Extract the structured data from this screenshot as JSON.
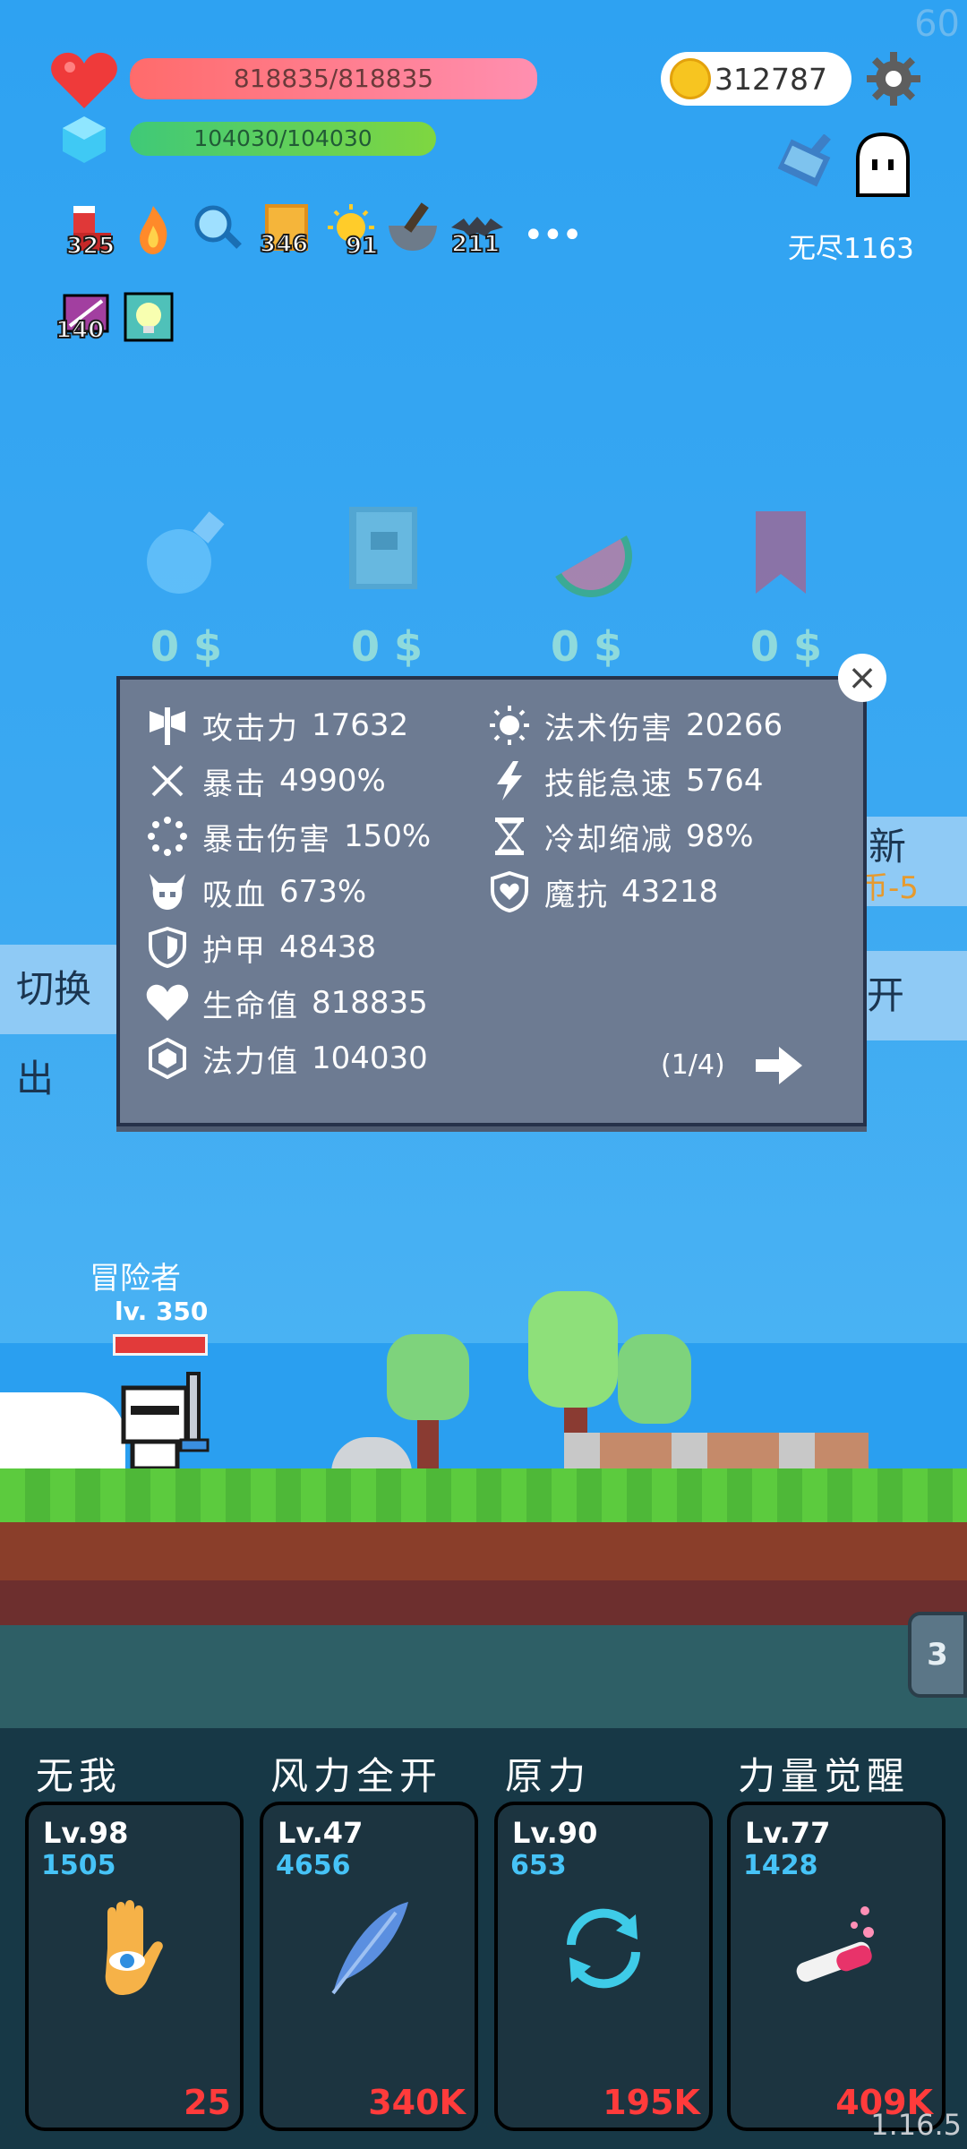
{
  "hud": {
    "fps": "60",
    "hp_text": "818835/818835",
    "mp_text": "104030/104030",
    "gold": "312787",
    "endless_label": "无尽1163",
    "version": "1.16.5"
  },
  "buffs": [
    {
      "icon": "boot-icon",
      "count": "325"
    },
    {
      "icon": "flame-icon",
      "count": ""
    },
    {
      "icon": "magnifier-icon",
      "count": ""
    },
    {
      "icon": "book-icon",
      "count": "346"
    },
    {
      "icon": "sun-icon",
      "count": "91"
    },
    {
      "icon": "mortar-icon",
      "count": ""
    },
    {
      "icon": "bat-icon",
      "count": "211"
    },
    {
      "icon": "scroll-icon",
      "count": "140"
    },
    {
      "icon": "lamp-icon",
      "count": ""
    }
  ],
  "shop": [
    {
      "icon": "potion-icon",
      "price": "0 $"
    },
    {
      "icon": "tome-icon",
      "price": "0 $"
    },
    {
      "icon": "watermelon-icon",
      "price": "0 $"
    },
    {
      "icon": "bookmark-icon",
      "price": "0 $"
    }
  ],
  "side": {
    "left_label": "切换出",
    "right_label_1": "新",
    "right_label_1b": "币-5",
    "right_label_2": "开"
  },
  "stats": {
    "left": [
      {
        "icon": "axe-icon",
        "name": "攻击力",
        "value": "17632"
      },
      {
        "icon": "crit-icon",
        "name": "暴击",
        "value": "4990%"
      },
      {
        "icon": "crit-damage-icon",
        "name": "暴击伤害",
        "value": "150%"
      },
      {
        "icon": "skull-icon",
        "name": "吸血",
        "value": "673%"
      },
      {
        "icon": "armor-icon",
        "name": "护甲",
        "value": "48438"
      },
      {
        "icon": "heart-icon",
        "name": "生命值",
        "value": "818835"
      },
      {
        "icon": "crystal-icon",
        "name": "法力值",
        "value": "104030"
      }
    ],
    "right": [
      {
        "icon": "sun-stat-icon",
        "name": "法术伤害",
        "value": "20266"
      },
      {
        "icon": "lightning-icon",
        "name": "技能急速",
        "value": "5764"
      },
      {
        "icon": "hourglass-icon",
        "name": "冷却缩减",
        "value": "98%"
      },
      {
        "icon": "shield-heart-icon",
        "name": "魔抗",
        "value": "43218"
      }
    ],
    "page": "(1/4)"
  },
  "character": {
    "name": "冒险者",
    "level": "lv. 350"
  },
  "wave_badge": "3",
  "skills": [
    {
      "title": "无我",
      "lv": "Lv.98",
      "value": "1505",
      "cost": "25",
      "icon": "hand-eye-icon"
    },
    {
      "title": "风力全开",
      "lv": "Lv.47",
      "value": "4656",
      "cost": "340K",
      "icon": "feather-icon"
    },
    {
      "title": "原力",
      "lv": "Lv.90",
      "value": "653",
      "cost": "195K",
      "icon": "cycle-icon"
    },
    {
      "title": "力量觉醒",
      "lv": "Lv.77",
      "value": "1428",
      "cost": "409K",
      "icon": "test-tube-icon"
    }
  ],
  "colors": {
    "sky": "#2ea2f2",
    "hp": "#ff6b6b",
    "mp": "#3fc978",
    "modal": "#6d7b92",
    "skill_cost": "#ff3b3b",
    "skill_value": "#46c3f7"
  }
}
